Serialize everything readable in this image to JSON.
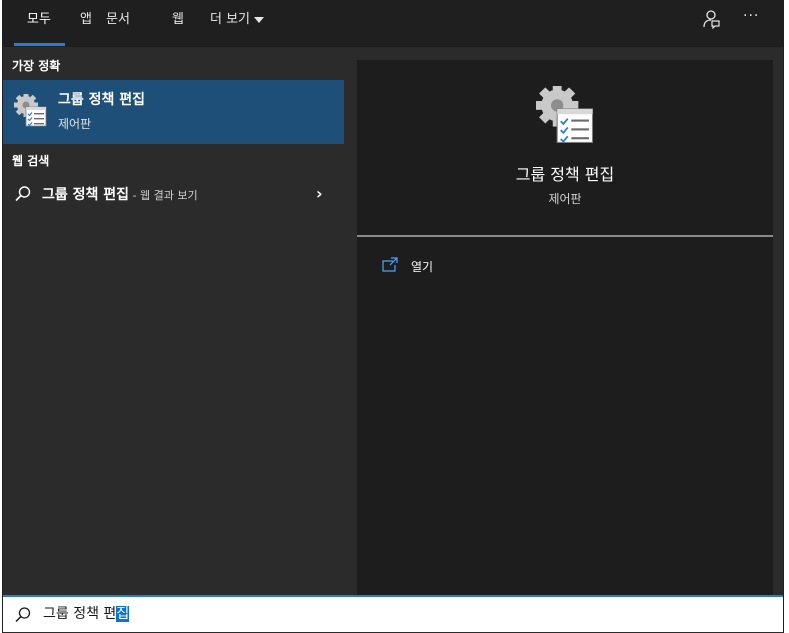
{
  "tabs": [
    {
      "label": "모두",
      "active": true
    },
    {
      "label": "앱",
      "active": false
    },
    {
      "label": "문서",
      "active": false
    },
    {
      "label": "웹",
      "active": false
    },
    {
      "label": "더 보기",
      "active": false
    }
  ],
  "toolbar": {
    "feedback_icon": "feedback-icon",
    "more_icon": "more-options-icon",
    "more_label": "···"
  },
  "left": {
    "best_match_heading": "가장 정확",
    "best_match": {
      "title": "그룹 정책 편집",
      "subtitle": "제어판",
      "icon": "group-policy-icon"
    },
    "web_heading": "웹 검색",
    "web_result": {
      "title": "그룹 정책 편집",
      "suffix": " - 웹 결과 보기",
      "chevron": "›"
    }
  },
  "right": {
    "title": "그룹 정책 편집",
    "subtitle": "제어판",
    "actions": [
      {
        "label": "열기",
        "icon": "open-icon"
      }
    ]
  },
  "search": {
    "query_prefix": "그룹 정책 편",
    "query_selected": "집"
  },
  "colors": {
    "accent": "#2b7bd6",
    "selected_item_bg": "#1d4f79",
    "pane_bg": "#2b2b2b",
    "detail_bg": "#1d1d1d"
  }
}
